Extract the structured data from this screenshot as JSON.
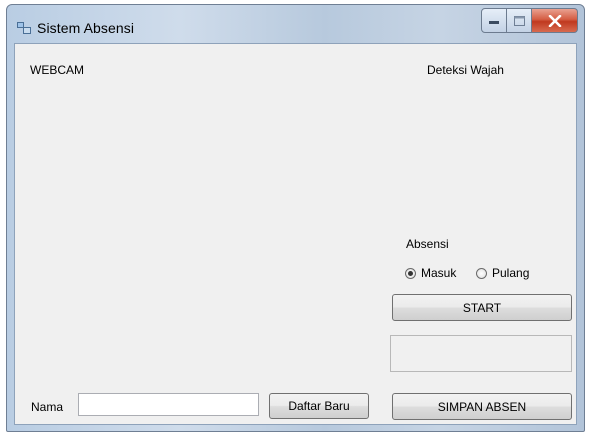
{
  "window": {
    "title": "Sistem Absensi"
  },
  "labels": {
    "webcam": "WEBCAM",
    "deteksi_wajah": "Deteksi Wajah",
    "absensi": "Absensi",
    "nama": "Nama"
  },
  "radios": {
    "masuk": "Masuk",
    "pulang": "Pulang",
    "selected": "Masuk"
  },
  "buttons": {
    "start": "START",
    "daftar_baru": "Daftar Baru",
    "simpan_absen": "SIMPAN ABSEN"
  },
  "inputs": {
    "nama_value": ""
  }
}
